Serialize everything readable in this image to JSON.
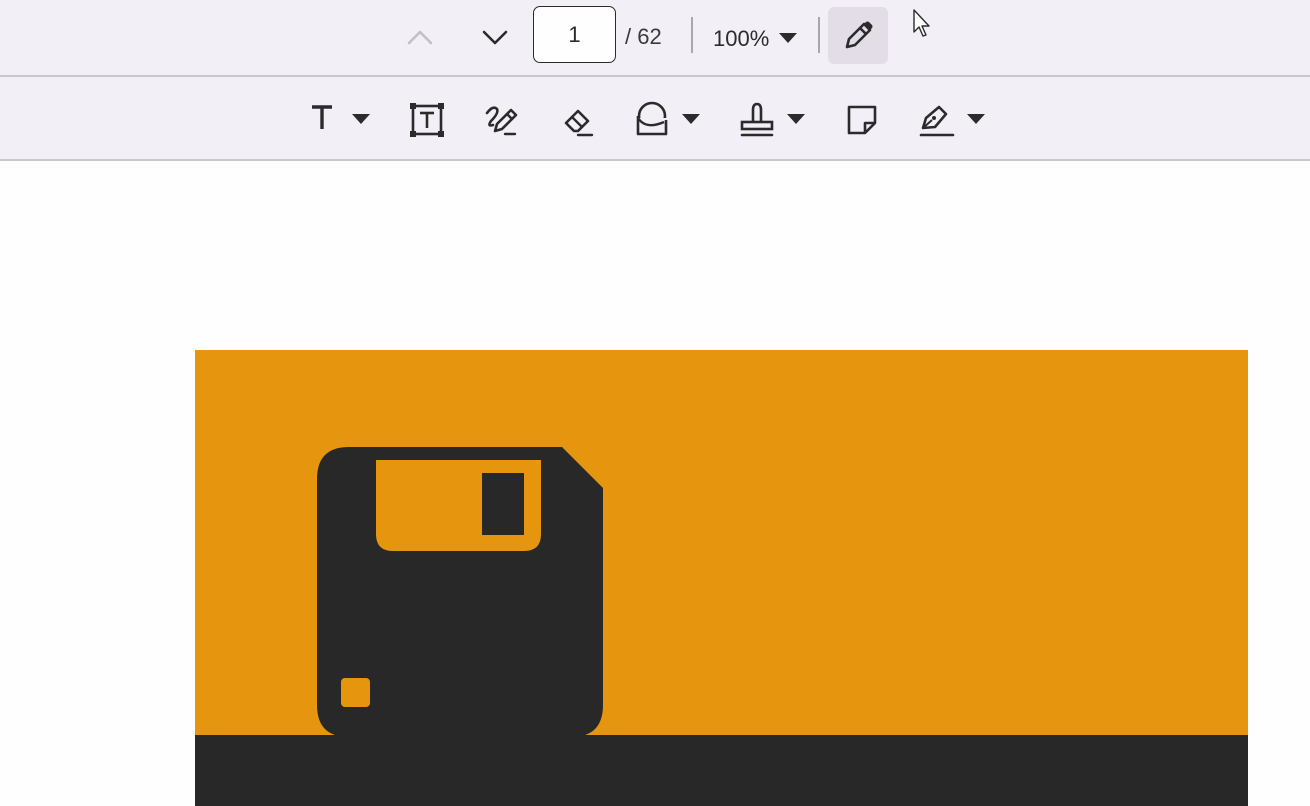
{
  "navigation": {
    "prev_icon": "chevron-up-icon",
    "next_icon": "chevron-down-icon",
    "current_page": "1",
    "total_pages": "/ 62"
  },
  "zoom": {
    "level": "100%",
    "dropdown_icon": "caret-down-icon"
  },
  "edit_mode": {
    "icon": "pencil-icon",
    "active": true
  },
  "annotation_toolbar": {
    "tools": [
      {
        "name": "text",
        "icon": "text-t-icon",
        "has_dropdown": true
      },
      {
        "name": "free-text",
        "icon": "text-box-icon",
        "has_dropdown": false
      },
      {
        "name": "draw",
        "icon": "draw-pen-icon",
        "has_dropdown": false
      },
      {
        "name": "eraser",
        "icon": "eraser-icon",
        "has_dropdown": false
      },
      {
        "name": "shapes",
        "icon": "shapes-icon",
        "has_dropdown": true
      },
      {
        "name": "stamp",
        "icon": "stamp-icon",
        "has_dropdown": true
      },
      {
        "name": "sticky-note",
        "icon": "sticky-note-icon",
        "has_dropdown": false
      },
      {
        "name": "signature",
        "icon": "signature-icon",
        "has_dropdown": true
      }
    ]
  },
  "colors": {
    "toolbar_bg": "#f3eff7",
    "page_bg": "#fefefe",
    "image_orange": "#e5960e",
    "image_dark": "#282828"
  },
  "document": {
    "image_icon": "floppy-disk-icon"
  }
}
